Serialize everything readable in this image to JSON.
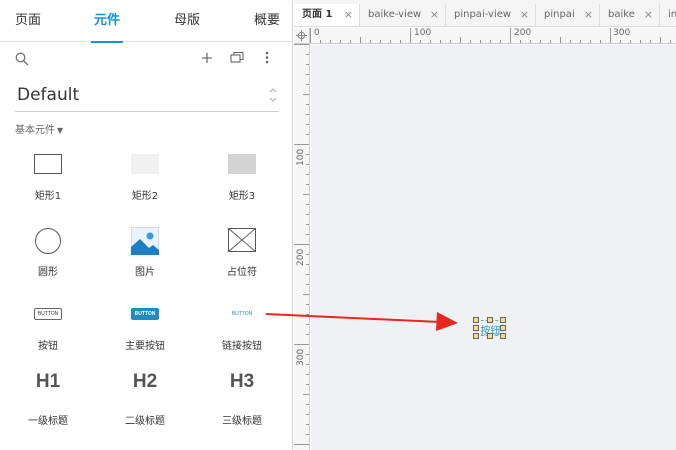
{
  "left_panel": {
    "tabs": [
      {
        "label": "页面",
        "active": false
      },
      {
        "label": "元件",
        "active": true
      },
      {
        "label": "母版",
        "active": false
      },
      {
        "label": "概要",
        "active": false
      }
    ],
    "library": {
      "selected": "Default"
    },
    "category": {
      "label": "基本元件"
    },
    "widgets": [
      {
        "label": "矩形1",
        "preview": "rect1"
      },
      {
        "label": "矩形2",
        "preview": "rect2"
      },
      {
        "label": "矩形3",
        "preview": "rect3"
      },
      {
        "label": "圆形",
        "preview": "circle"
      },
      {
        "label": "图片",
        "preview": "image"
      },
      {
        "label": "占位符",
        "preview": "placeholder"
      },
      {
        "label": "按钮",
        "preview": "button",
        "preview_text": "BUTTON"
      },
      {
        "label": "主要按钮",
        "preview": "button-primary",
        "preview_text": "BUTTON"
      },
      {
        "label": "链接按钮",
        "preview": "button-link",
        "preview_text": "BUTTON"
      },
      {
        "label": "一级标题",
        "preview": "heading",
        "preview_text": "H1"
      },
      {
        "label": "二级标题",
        "preview": "heading",
        "preview_text": "H2"
      },
      {
        "label": "三级标题",
        "preview": "heading",
        "preview_text": "H3"
      }
    ]
  },
  "document_tabs": [
    {
      "label": "页面 1",
      "active": true
    },
    {
      "label": "baike-view",
      "active": false
    },
    {
      "label": "pinpai-view",
      "active": false
    },
    {
      "label": "pinpai",
      "active": false
    },
    {
      "label": "baike",
      "active": false
    },
    {
      "label": "in",
      "active": false
    }
  ],
  "rulers": {
    "horizontal": [
      "0",
      "100",
      "200",
      "300"
    ],
    "vertical": [
      "100",
      "200",
      "300"
    ]
  },
  "canvas": {
    "selected_widget_text": "按钮"
  },
  "colors": {
    "accent": "#1296db",
    "arrow": "#e8271f",
    "canvas_bg": "#f0f1f5",
    "primary_button": "#1e8bc3"
  },
  "icons": {
    "search": "search-icon",
    "add": "plus-icon",
    "duplicate": "copy-icon",
    "more": "more-vertical-icon",
    "select_arrows": "chevron-updown-icon",
    "category_caret": "caret-down-icon",
    "tab_close": "close-icon",
    "ruler_corner": "crosshair-icon"
  }
}
